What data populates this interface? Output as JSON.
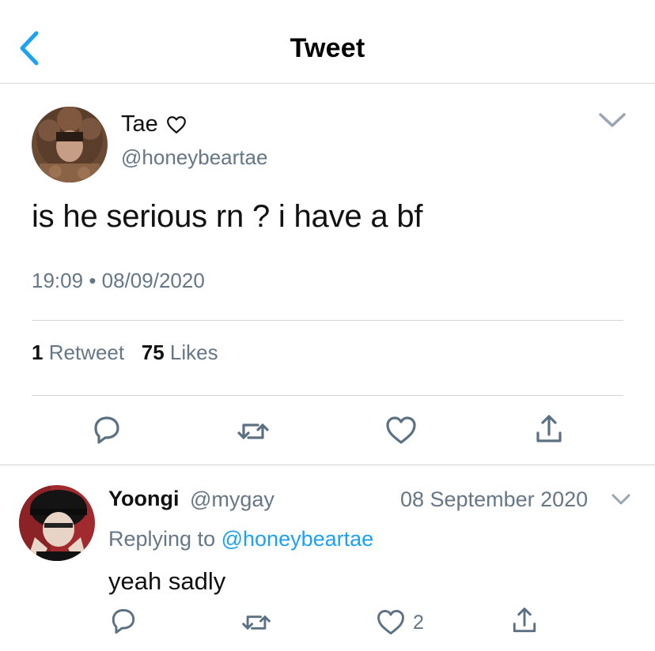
{
  "header": {
    "title": "Tweet",
    "back_icon": "chevron-left-icon"
  },
  "main_tweet": {
    "author_name": "Tae",
    "name_emoji_icon": "heart-outline-icon",
    "handle": "@honeybeartae",
    "text": "is he serious rn ? i have a bf",
    "time": "19:09",
    "separator": "•",
    "date": "08/09/2020",
    "retweets_count": "1",
    "retweets_label": "Retweet",
    "likes_count": "75",
    "likes_label": "Likes",
    "actions": [
      "reply-icon",
      "retweet-icon",
      "like-icon",
      "share-icon"
    ]
  },
  "reply_tweet": {
    "author_name": "Yoongi",
    "handle": "@mygay",
    "date": "08 September 2020",
    "replying_prefix": "Replying to",
    "replying_to": "@honeybeartae",
    "text": "yeah sadly",
    "like_count": "2",
    "actions": [
      "reply-icon",
      "retweet-icon",
      "like-icon",
      "share-icon"
    ]
  },
  "colors": {
    "accent": "#1da1f2",
    "muted": "#657786",
    "divider": "#d6d6d6",
    "icon": "#5b7083"
  }
}
